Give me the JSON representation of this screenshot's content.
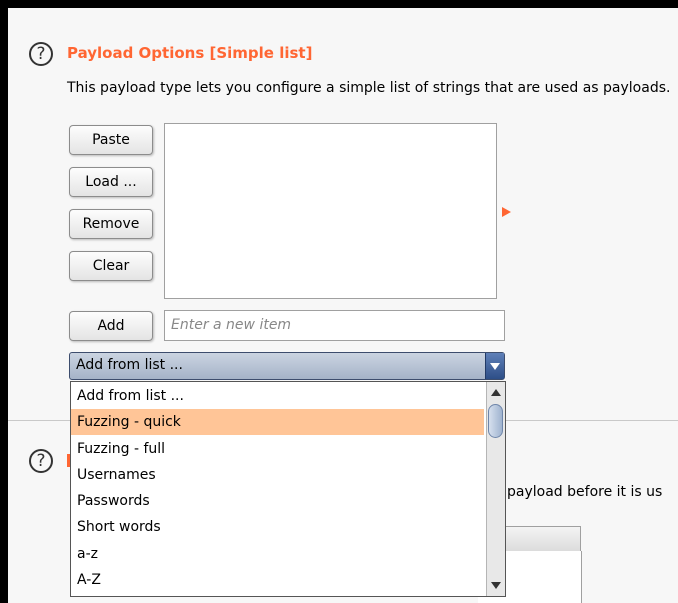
{
  "section1": {
    "help_glyph": "?",
    "title": "Payload Options [Simple list]",
    "description": "This payload type lets you configure a simple list of strings that are used as payloads.",
    "buttons": {
      "paste": "Paste",
      "load": "Load ...",
      "remove": "Remove",
      "clear": "Clear",
      "add": "Add"
    },
    "new_item_placeholder": "Enter a new item",
    "add_from_list": {
      "selected": "Add from list ...",
      "options": [
        "Add from list ...",
        "Fuzzing - quick",
        "Fuzzing - full",
        "Usernames",
        "Passwords",
        "Short words",
        "a-z",
        "A-Z"
      ],
      "highlighted": "Fuzzing - quick"
    }
  },
  "section2": {
    "help_glyph": "?",
    "partial_description": "ch payload before it is us"
  },
  "colors": {
    "accent": "#ff6633",
    "highlight": "#ffc597",
    "combo": "#a5b3c8"
  }
}
